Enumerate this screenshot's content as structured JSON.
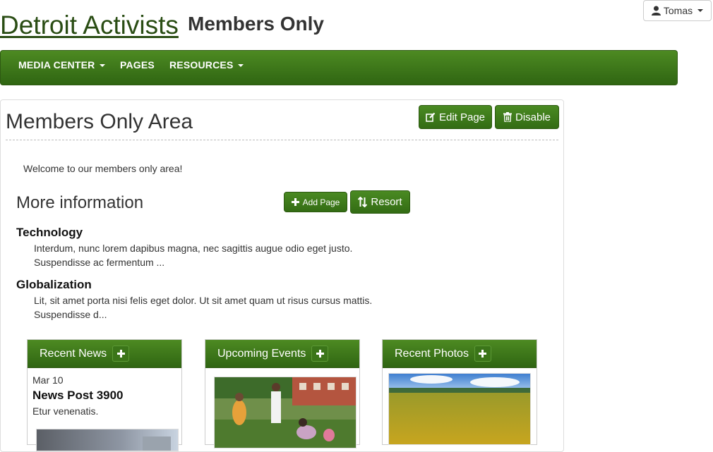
{
  "header": {
    "site_title": "Detroit Activists",
    "section_title": "Members Only",
    "user_name": "Tomas"
  },
  "nav": {
    "items": [
      {
        "label": "MEDIA CENTER",
        "dropdown": true
      },
      {
        "label": "PAGES",
        "dropdown": false
      },
      {
        "label": "RESOURCES",
        "dropdown": true
      }
    ]
  },
  "page": {
    "title": "Members Only Area",
    "edit_label": "Edit Page",
    "disable_label": "Disable",
    "welcome": "Welcome to our members only area!",
    "more_info_title": "More information",
    "add_page_label": "Add Page",
    "resort_label": "Resort",
    "items": [
      {
        "title": "Technology",
        "desc": "Interdum, nunc lorem dapibus magna, nec sagittis augue odio eget justo. Suspendisse ac fermentum ..."
      },
      {
        "title": "Globalization",
        "desc": "Lit, sit amet porta nisi felis eget dolor. Ut sit amet quam ut risus cursus mattis. Suspendisse d..."
      }
    ]
  },
  "widgets": {
    "news": {
      "title": "Recent News",
      "date": "Mar 10",
      "post_title": "News Post 3900",
      "post_body": "Etur venenatis."
    },
    "events": {
      "title": "Upcoming Events"
    },
    "photos": {
      "title": "Recent Photos"
    }
  },
  "colors": {
    "brand_green": "#3f7a1a",
    "title_green": "#2a4d14"
  }
}
